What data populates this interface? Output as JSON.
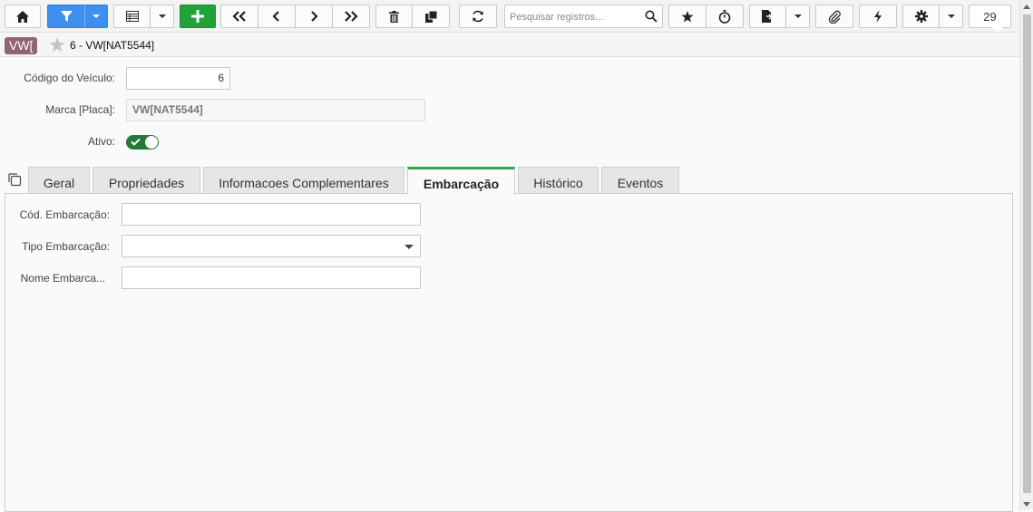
{
  "toolbar": {
    "search_placeholder": "Pesquisar registros...",
    "record_count": "29"
  },
  "title": {
    "badge": "VW[",
    "record": "6 - VW[NAT5544]"
  },
  "form": {
    "codigo_label": "Código do Veículo:",
    "codigo_value": "6",
    "marca_label": "Marca [Placa]:",
    "marca_value": "VW[NAT5544]",
    "ativo_label": "Ativo:",
    "ativo_on": true
  },
  "tabs": [
    {
      "label": "Geral"
    },
    {
      "label": "Propriedades"
    },
    {
      "label": "Informacoes Complementares"
    },
    {
      "label": "Embarcação",
      "active": true
    },
    {
      "label": "Histórico"
    },
    {
      "label": "Eventos"
    }
  ],
  "embarcacao": {
    "cod_label": "Cód. Embarcação:",
    "cod_value": "",
    "tipo_label": "Tipo Embarcação:",
    "tipo_value": "",
    "nome_label": "Nome Embarca...",
    "nome_value": ""
  },
  "colors": {
    "primary": "#3d8ff0",
    "add": "#22a33a",
    "badge": "#8f6671",
    "active_tab": "#2fa84f",
    "toggle": "#217a35"
  },
  "icons": [
    "home-icon",
    "filter-icon",
    "table-icon",
    "plus-icon",
    "first-icon",
    "prev-icon",
    "next-icon",
    "last-icon",
    "trash-icon",
    "copy-icon",
    "refresh-icon",
    "search-icon",
    "star-icon",
    "stopwatch-icon",
    "export-icon",
    "paperclip-icon",
    "bolt-icon",
    "gear-icon"
  ]
}
